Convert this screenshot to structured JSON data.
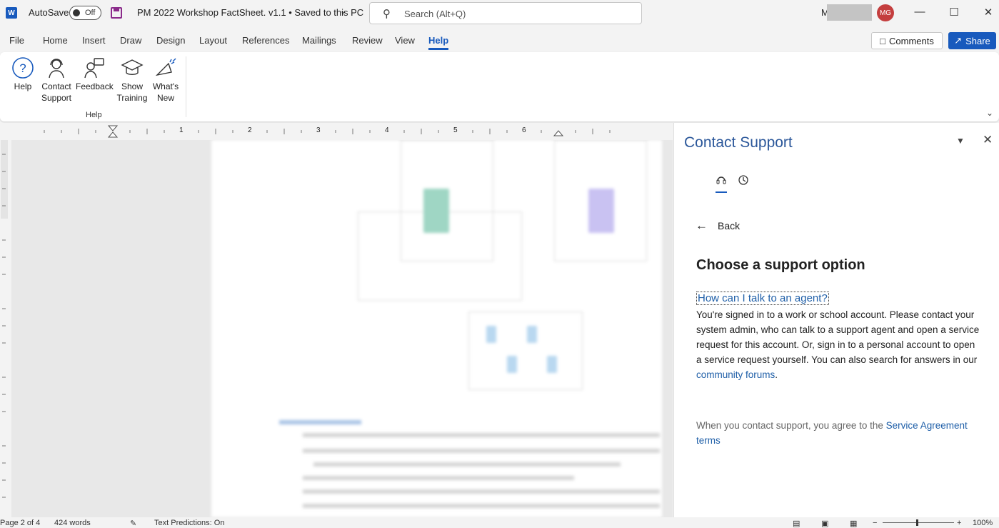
{
  "titlebar": {
    "app_icon": "W",
    "autosave_label": "AutoSave",
    "autosave_state": "Off",
    "document_title": "PM 2022 Workshop FactSheet. v1.1 • Saved to this PC",
    "search_placeholder": "Search (Alt+Q)",
    "user_initial": "M",
    "avatar_initials": "MG"
  },
  "menu": {
    "tabs": [
      "File",
      "Home",
      "Insert",
      "Draw",
      "Design",
      "Layout",
      "References",
      "Mailings",
      "Review",
      "View",
      "Help"
    ],
    "active_tab": "Help",
    "comments_label": "Comments",
    "share_label": "Share"
  },
  "ribbon": {
    "buttons": [
      {
        "line1": "Help",
        "line2": ""
      },
      {
        "line1": "Contact",
        "line2": "Support"
      },
      {
        "line1": "Feedback",
        "line2": ""
      },
      {
        "line1": "Show",
        "line2": "Training"
      },
      {
        "line1": "What's",
        "line2": "New"
      }
    ],
    "group_label": "Help"
  },
  "ruler": {
    "numbers": [
      "1",
      "2",
      "3",
      "4",
      "5",
      "6"
    ]
  },
  "pane": {
    "title": "Contact Support",
    "back_label": "Back",
    "heading": "Choose a support option",
    "agent_link": "How can I talk to an agent?",
    "body_text": "You're signed in to a work or school account. Please contact your system admin, who can talk to a support agent and open a service request for this account. Or, sign in to a personal account to open a service request yourself. You can also search for answers in our ",
    "community_link": "community forums",
    "body_end": ".",
    "agree_text": "When you contact support, you agree to the ",
    "agreement_link": "Service Agreement terms"
  },
  "statusbar": {
    "page": "Page 2 of 4",
    "words": "424 words",
    "text_predictions": "Text Predictions: On",
    "zoom": "100%"
  },
  "colors": {
    "accent": "#185abd",
    "pane_title": "#2b579a",
    "link": "#1f5fa8"
  }
}
